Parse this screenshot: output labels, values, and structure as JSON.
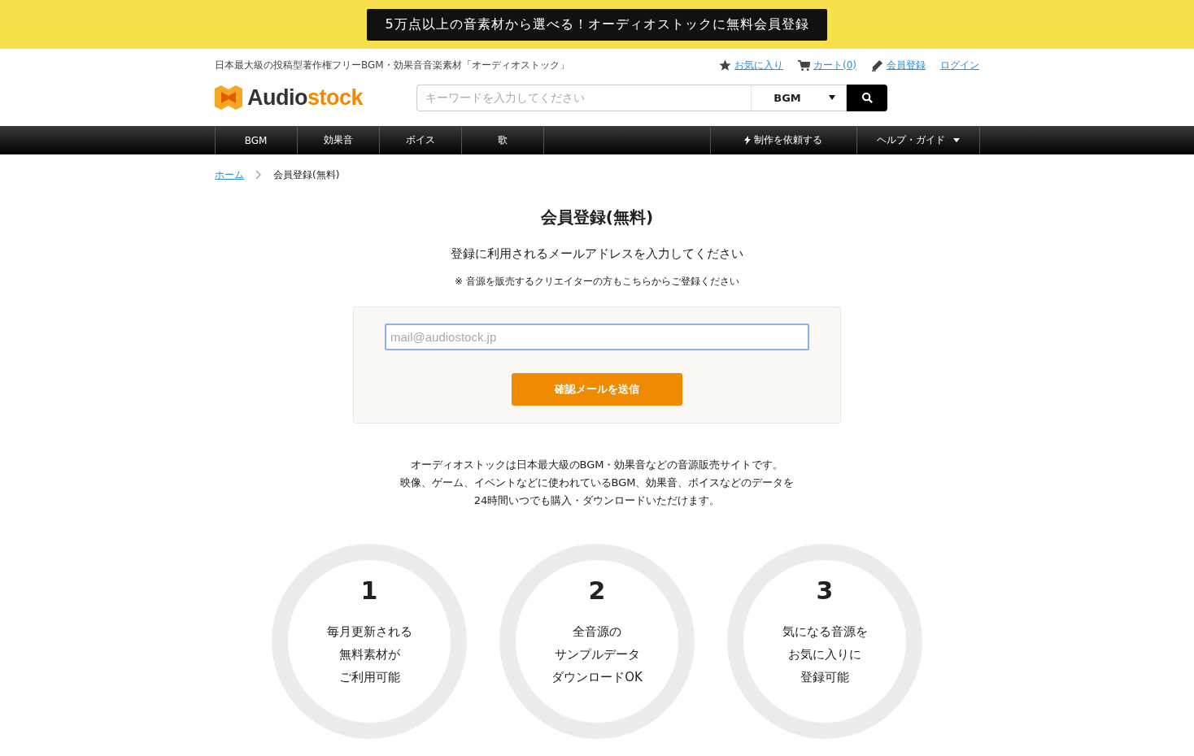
{
  "banner": {
    "text": "5万点以上の音素材から選べる！オーディオストックに無料会員登録"
  },
  "header": {
    "tagline": "日本最大級の投稿型著作権フリーBGM・効果音音楽素材「オーディオストック」",
    "links": [
      {
        "kind": "star",
        "label": "お気に入り"
      },
      {
        "kind": "cart",
        "label": "カート(0)"
      },
      {
        "kind": "pencil",
        "label": "会員登録"
      },
      {
        "kind": "none",
        "label": "ログイン"
      }
    ],
    "logo": {
      "main": "Audio",
      "accent": "stock"
    },
    "search": {
      "placeholder": "キーワードを入力してください",
      "category": "BGM"
    }
  },
  "nav": {
    "items": [
      {
        "label": "BGM"
      },
      {
        "label": "効果音"
      },
      {
        "label": "ボイス"
      },
      {
        "label": "歌"
      }
    ],
    "right_items": [
      {
        "kind": "bolt",
        "label": "制作を依頼する"
      },
      {
        "kind": "caret",
        "label": "ヘルプ・ガイド"
      }
    ]
  },
  "breadcrumb": [
    {
      "label": "ホーム",
      "link": true
    },
    {
      "label": "会員登録(無料)",
      "link": false
    }
  ],
  "title": "会員登録(無料)",
  "subtitle": "登録に利用されるメールアドレスを入力してください",
  "note": "※ 音源を販売するクリエイターの方もこちらからご登録ください",
  "form": {
    "placeholder": "mail@audiostock.jp",
    "button": "確認メールを送信"
  },
  "description": [
    "オーディオストックは日本最大級のBGM・効果音などの音源販売サイトです。",
    "映像、ゲーム、イベントなどに使われているBGM、効果音、ボイスなどのデータを",
    "24時間いつでも購入・ダウンロードいただけます。"
  ],
  "features": [
    {
      "number": "1",
      "lines": [
        "毎月更新される",
        "無料素材が",
        "ご利用可能"
      ]
    },
    {
      "number": "2",
      "lines": [
        "全音源の",
        "サンプルデータ",
        "ダウンロードOK"
      ]
    },
    {
      "number": "3",
      "lines": [
        "気になる音源を",
        "お気に入りに",
        "登録可能"
      ]
    }
  ]
}
